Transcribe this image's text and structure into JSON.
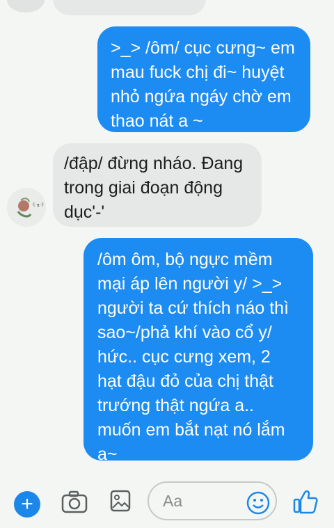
{
  "messages": [
    {
      "direction": "outgoing",
      "text": ">_> /ôm/ cục cưng~ em\nmau fuck chị đi~ huyệt\nnhỏ ngứa ngáy chờ em\nthao nát a ~"
    },
    {
      "direction": "incoming",
      "text": "/đập/ đừng nháo. Đang\ntrong giai đoạn động\ndục'-'"
    },
    {
      "direction": "outgoing",
      "text": "/ôm ôm, bộ ngực mềm\nmại áp lên người y/ >_>\nngười ta cứ thích náo thì\nsao~/phả khí vào cổ y/\nhức.. cục cưng xem, 2\nhạt đậu đỏ của chị thật\ntrướng thật ngứa a..\nmuốn em bắt nạt nó lắm\na~"
    }
  ],
  "composer": {
    "placeholder": "Aa",
    "icons": [
      "plus-icon",
      "camera-icon",
      "gallery-icon",
      "emoji-icon",
      "like-icon"
    ]
  },
  "colors": {
    "outgoing_bubble": "#1c8bf2",
    "incoming_bubble": "#e6e8e8",
    "accent": "#1c87e8",
    "background": "#f4f6f4"
  }
}
